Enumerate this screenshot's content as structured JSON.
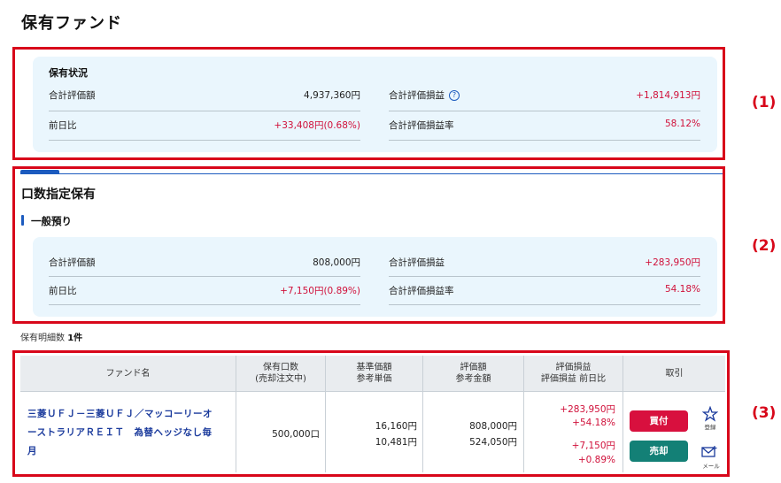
{
  "page": {
    "title": "保有ファンド"
  },
  "markers": [
    "(1)",
    "(2)",
    "(3)"
  ],
  "summary": {
    "heading": "保有状況",
    "rows": [
      {
        "left_label": "合計評価額",
        "left_value": "4,937,360円",
        "right_label": "合計評価損益",
        "right_value": "+1,814,913円"
      },
      {
        "left_label": "前日比",
        "left_value": "+33,408円(0.68%)",
        "right_label": "合計評価損益率",
        "right_value": "58.12%"
      }
    ]
  },
  "section": {
    "title": "口数指定保有",
    "subtitle": "一般預り",
    "rows": [
      {
        "left_label": "合計評価額",
        "left_value": "808,000円",
        "right_label": "合計評価損益",
        "right_value": "+283,950円"
      },
      {
        "left_label": "前日比",
        "left_value": "+7,150円(0.89%)",
        "right_label": "合計評価損益率",
        "right_value": "54.18%"
      }
    ]
  },
  "count": {
    "label": "保有明細数",
    "value": "1件"
  },
  "table": {
    "headers": [
      [
        "ファンド名"
      ],
      [
        "保有口数",
        "(売却注文中)"
      ],
      [
        "基準価額",
        "参考単価"
      ],
      [
        "評価額",
        "参考金額"
      ],
      [
        "評価損益",
        "評価損益 前日比"
      ],
      [
        "取引"
      ]
    ],
    "row": {
      "fund_name_lines": [
        "三菱ＵＦＪ－三菱ＵＦＪ／マッコーリーオ",
        "ーストラリアＲＥＩＴ　為替ヘッジなし毎",
        "月"
      ],
      "units": "500,000口",
      "base_price": "16,160円",
      "unit_cost": "10,481円",
      "valuation": "808,000円",
      "ref_amount": "524,050円",
      "gain": "+283,950円",
      "gain_rate": "+54.18%",
      "day_change": "+7,150円",
      "day_change_rate": "+0.89%",
      "buy_label": "買付",
      "sell_label": "売却",
      "register_label": "登録",
      "mail_label": "メール"
    }
  },
  "icons": {
    "help": "help-circle-icon",
    "register": "star-plus-icon",
    "mail": "mail-plus-icon"
  },
  "colors": {
    "highlight": "#d8071a",
    "positive": "#d0103a",
    "accent": "#1c5bbf",
    "buy": "#d8103e",
    "sell": "#138076",
    "panel": "#eaf6fd"
  }
}
